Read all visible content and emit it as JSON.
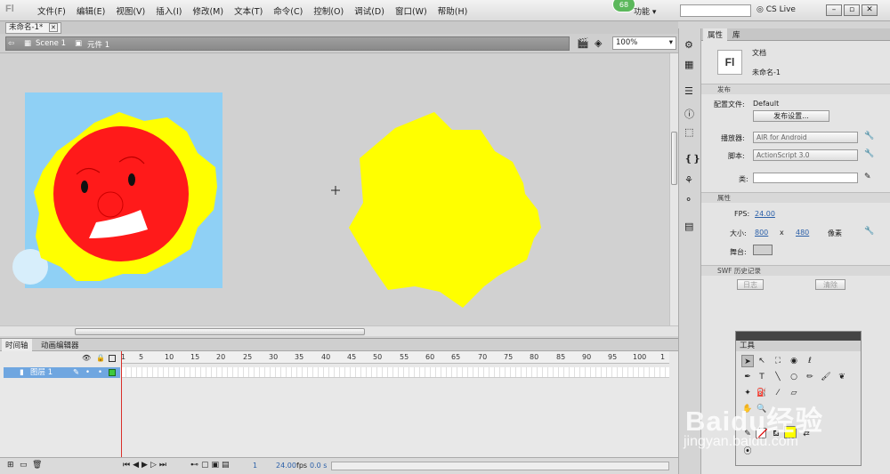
{
  "menubar": {
    "items": [
      "文件(F)",
      "编辑(E)",
      "视图(V)",
      "插入(I)",
      "修改(M)",
      "文本(T)",
      "命令(C)",
      "控制(O)",
      "调试(D)",
      "窗口(W)",
      "帮助(H)"
    ],
    "badge": "68",
    "gongneng": "功能 ▾",
    "cs_live": "CS Live"
  },
  "document": {
    "tab_label": "未命名-1*"
  },
  "editbar": {
    "scene": "Scene 1",
    "symbol": "元件 1",
    "zoom": "100%"
  },
  "timeline": {
    "tabs": [
      "时间轴",
      "动画编辑器"
    ],
    "ruler": [
      "1",
      "5",
      "10",
      "15",
      "20",
      "25",
      "30",
      "35",
      "40",
      "45",
      "50",
      "55",
      "60",
      "65",
      "70",
      "75",
      "80",
      "85",
      "90",
      "95",
      "100",
      "1"
    ],
    "layer_name": "图层 1",
    "footer": {
      "frame": "1",
      "fps": "24.00",
      "fps_unit": "fps",
      "time": "0.0 s"
    }
  },
  "properties": {
    "tabs": [
      "属性",
      "库"
    ],
    "doc_icon": "Fl",
    "doc_type": "文档",
    "doc_name": "未命名-1",
    "publish_section": "发布",
    "profile_label": "配置文件:",
    "profile_value": "Default",
    "publish_settings": "发布设置...",
    "player_label": "播放器:",
    "player_value": "AIR for Android",
    "script_label": "脚本:",
    "script_value": "ActionScript 3.0",
    "class_label": "类:",
    "props_section": "属性",
    "fps_label": "FPS:",
    "fps_value": "24.00",
    "size_label": "大小:",
    "width": "800",
    "x": "x",
    "height": "480",
    "unit": "像素",
    "stage_label": "舞台:",
    "swf_section": "SWF 历史记录",
    "log_button": "日志",
    "clear_button": "清除"
  },
  "tools_panel": {
    "title": "工具"
  },
  "watermark": {
    "main": "Baidu经验",
    "url": "jingyan.baidu.com"
  },
  "colors": {
    "sun_yellow": "#ffff00",
    "face_red": "#ff1a1a",
    "sky": "#8fd0f5",
    "timeline_layer": "#6fa6e0"
  }
}
